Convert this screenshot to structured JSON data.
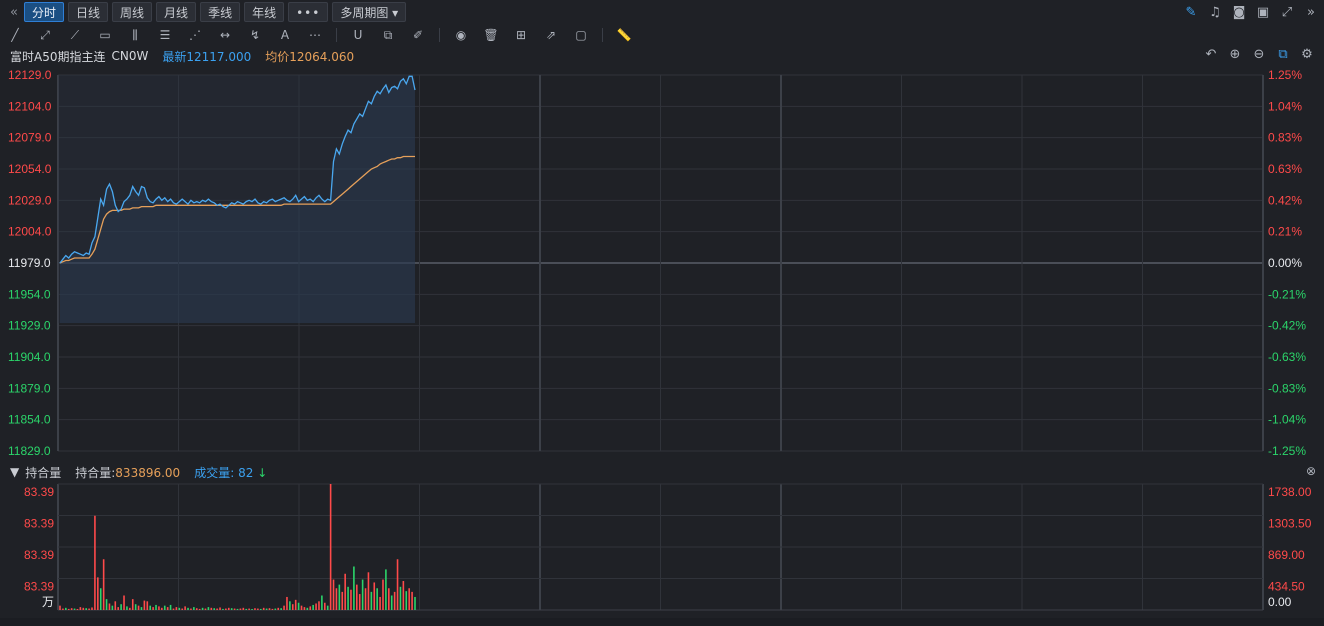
{
  "topbar": {
    "collapse_icon": "«",
    "tabs": [
      "分时",
      "日线",
      "周线",
      "月线",
      "季线",
      "年线"
    ],
    "active_tab": 0,
    "more_label": "•••",
    "period_select": "多周期图 ▾"
  },
  "symbol": {
    "name": "富时A50期指主连",
    "code": "CN0W",
    "last_label": "最新12117.000",
    "avg_label": "均价12064.060"
  },
  "price_axis": {
    "left": [
      "12129.0",
      "12104.0",
      "12079.0",
      "12054.0",
      "12029.0",
      "12004.0",
      "11979.0",
      "11954.0",
      "11929.0",
      "11904.0",
      "11879.0",
      "11854.0",
      "11829.0"
    ],
    "right": [
      "1.25%",
      "1.04%",
      "0.83%",
      "0.63%",
      "0.42%",
      "0.21%",
      "0.00%",
      "-0.21%",
      "-0.42%",
      "-0.63%",
      "-0.83%",
      "-1.04%",
      "-1.25%"
    ],
    "base_index": 6
  },
  "volume_panel": {
    "toggle_icon": "▼",
    "title": "持合量",
    "oi_label": "持合量:",
    "oi_value": "833896.00",
    "vol_label": "成交量:",
    "vol_value": "82",
    "trend_icon": "↓",
    "close_icon": "⊗",
    "left_ticks": [
      "83.39",
      "83.39",
      "83.39",
      "83.39",
      "万"
    ],
    "right_ticks": [
      "1738.00",
      "1303.50",
      "869.00",
      "434.50",
      "0.00"
    ]
  },
  "colors": {
    "up": "#ff4a4a",
    "down": "#2bd56a",
    "price_line": "#4aa8f0",
    "avg_line": "#e6a05a",
    "grid": "#30333a"
  },
  "chart_data": {
    "type": "line",
    "series": [
      {
        "name": "最新",
        "values": [
          11979,
          11982,
          11985,
          11983,
          11986,
          11988,
          11987,
          11986,
          11985,
          11987,
          11986,
          11995,
          12000,
          12015,
          12030,
          12025,
          12038,
          12042,
          12036,
          12025,
          12020,
          12022,
          12028,
          12030,
          12033,
          12040,
          12036,
          12033,
          12040,
          12039,
          12031,
          12028,
          12027,
          12030,
          12032,
          12029,
          12031,
          12028,
          12030,
          12027,
          12026,
          12028,
          12030,
          12028,
          12026,
          12029,
          12027,
          12028,
          12027,
          12029,
          12028,
          12030,
          12028,
          12027,
          12025,
          12026,
          12024,
          12023,
          12025,
          12027,
          12026,
          12028,
          12027,
          12026,
          12028,
          12029,
          12028,
          12030,
          12027,
          12026,
          12028,
          12027,
          12029,
          12030,
          12028,
          12029,
          12030,
          12031,
          12029,
          12028,
          12030,
          12033,
          12028,
          12030,
          12032,
          12029,
          12030,
          12028,
          12031,
          12033,
          12030,
          12028,
          12030,
          12029,
          12060,
          12070,
          12066,
          12074,
          12080,
          12085,
          12083,
          12090,
          12094,
          12098,
          12096,
          12102,
          12108,
          12106,
          12112,
          12116,
          12114,
          12118,
          12121,
          12115,
          12119,
          12120,
          12118,
          12124,
          12126,
          12122,
          12128,
          12128,
          12117
        ]
      },
      {
        "name": "均价",
        "values": [
          11979,
          11980,
          11981,
          11981,
          11982,
          11983,
          11983,
          11983,
          11983,
          11983,
          11983,
          11986,
          11990,
          11998,
          12006,
          12014,
          12018,
          12020,
          12021,
          12021,
          12021,
          12021,
          12022,
          12022,
          12022,
          12023,
          12023,
          12023,
          12024,
          12024,
          12024,
          12024,
          12024,
          12025,
          12025,
          12025,
          12025,
          12025,
          12025,
          12025,
          12025,
          12025,
          12025,
          12025,
          12025,
          12025,
          12025,
          12025,
          12025,
          12025,
          12025,
          12025,
          12025,
          12025,
          12025,
          12025,
          12025,
          12025,
          12025,
          12025,
          12025,
          12025,
          12025,
          12025,
          12025,
          12025,
          12025,
          12025,
          12025,
          12025,
          12025,
          12025,
          12025,
          12025,
          12025,
          12025,
          12025,
          12026,
          12026,
          12026,
          12026,
          12026,
          12026,
          12026,
          12026,
          12026,
          12026,
          12026,
          12026,
          12026,
          12026,
          12026,
          12026,
          12026,
          12028,
          12030,
          12032,
          12034,
          12036,
          12038,
          12040,
          12042,
          12044,
          12046,
          12048,
          12050,
          12052,
          12054,
          12055,
          12056,
          12058,
          12059,
          12060,
          12061,
          12062,
          12062,
          12063,
          12063,
          12064,
          12064,
          12064,
          12064,
          12064
        ]
      }
    ],
    "volume": [
      60,
      20,
      30,
      15,
      25,
      20,
      10,
      40,
      30,
      25,
      20,
      35,
      1300,
      450,
      300,
      700,
      150,
      90,
      60,
      120,
      40,
      80,
      200,
      50,
      30,
      150,
      80,
      60,
      40,
      130,
      120,
      60,
      40,
      70,
      50,
      30,
      60,
      40,
      70,
      20,
      40,
      30,
      20,
      50,
      30,
      20,
      40,
      25,
      15,
      30,
      20,
      40,
      30,
      25,
      20,
      35,
      15,
      20,
      30,
      25,
      20,
      15,
      20,
      30,
      15,
      20,
      10,
      25,
      20,
      15,
      30,
      20,
      25,
      15,
      20,
      30,
      25,
      60,
      180,
      120,
      80,
      140,
      100,
      60,
      40,
      30,
      50,
      70,
      90,
      120,
      200,
      100,
      60,
      1738,
      420,
      300,
      350,
      250,
      500,
      320,
      280,
      600,
      350,
      220,
      420,
      300,
      520,
      250,
      380,
      300,
      180,
      420,
      560,
      300,
      200,
      250,
      700,
      320,
      400,
      260,
      300,
      250,
      180
    ],
    "volume_dir": [
      "u",
      "u",
      "d",
      "u",
      "u",
      "d",
      "u",
      "u",
      "u",
      "d",
      "u",
      "u",
      "u",
      "u",
      "d",
      "u",
      "d",
      "u",
      "d",
      "u",
      "u",
      "d",
      "u",
      "d",
      "u",
      "u",
      "d",
      "u",
      "d",
      "u",
      "u",
      "d",
      "u",
      "d",
      "u",
      "u",
      "d",
      "u",
      "d",
      "u",
      "u",
      "d",
      "u",
      "u",
      "d",
      "u",
      "d",
      "u",
      "u",
      "d",
      "u",
      "d",
      "u",
      "d",
      "u",
      "u",
      "d",
      "u",
      "u",
      "d",
      "u",
      "d",
      "u",
      "u",
      "d",
      "u",
      "d",
      "u",
      "u",
      "d",
      "u",
      "d",
      "u",
      "u",
      "d",
      "u",
      "d",
      "u",
      "u",
      "d",
      "u",
      "u",
      "d",
      "u",
      "u",
      "d",
      "u",
      "d",
      "u",
      "u",
      "d",
      "u",
      "d",
      "u",
      "u",
      "u",
      "d",
      "u",
      "u",
      "d",
      "u",
      "d",
      "u",
      "u",
      "d",
      "u",
      "u",
      "d",
      "u",
      "d",
      "u",
      "u",
      "d",
      "u",
      "d",
      "u",
      "u",
      "d",
      "u",
      "d",
      "u",
      "u",
      "d"
    ],
    "ylim": [
      11829,
      12129
    ],
    "xlabel": "",
    "ylabel": ""
  }
}
